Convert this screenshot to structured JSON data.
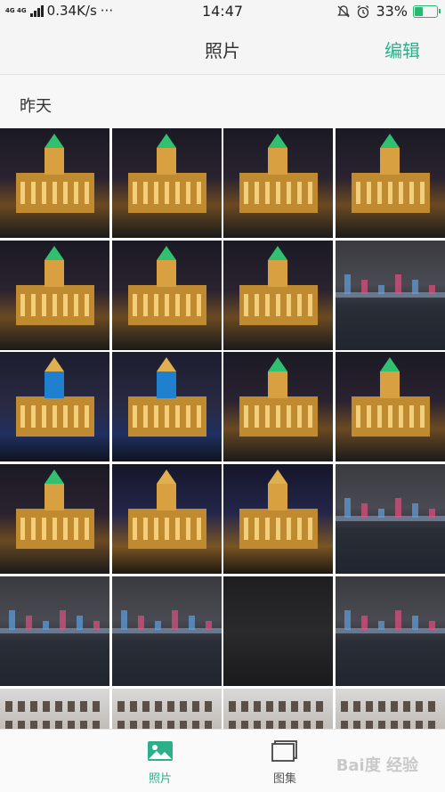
{
  "status_bar": {
    "network": "4G 4G",
    "speed": "0.34K/s",
    "more": "···",
    "time": "14:47",
    "battery_percent": "33%",
    "battery_level": 0.33
  },
  "header": {
    "title": "照片",
    "edit_label": "编辑"
  },
  "section": {
    "label": "昨天"
  },
  "photos": [
    {
      "kind": "night-building"
    },
    {
      "kind": "night-building"
    },
    {
      "kind": "night-building"
    },
    {
      "kind": "night-building"
    },
    {
      "kind": "night-building"
    },
    {
      "kind": "night-building"
    },
    {
      "kind": "night-building"
    },
    {
      "kind": "night-river"
    },
    {
      "kind": "night-tower"
    },
    {
      "kind": "night-tower"
    },
    {
      "kind": "night-building"
    },
    {
      "kind": "night-building"
    },
    {
      "kind": "night-building"
    },
    {
      "kind": "night-clocktower"
    },
    {
      "kind": "night-clocktower"
    },
    {
      "kind": "night-river"
    },
    {
      "kind": "night-river"
    },
    {
      "kind": "night-river"
    },
    {
      "kind": "dark-water"
    },
    {
      "kind": "night-river"
    },
    {
      "kind": "day-building"
    },
    {
      "kind": "day-building"
    },
    {
      "kind": "day-building"
    },
    {
      "kind": "day-building"
    }
  ],
  "tabs": [
    {
      "label": "照片",
      "icon": "photos-icon",
      "active": true
    },
    {
      "label": "图集",
      "icon": "albums-icon",
      "active": false
    }
  ],
  "watermark": "Bai度 经验",
  "colors": {
    "accent": "#2bb08a",
    "battery": "#2bb673"
  }
}
